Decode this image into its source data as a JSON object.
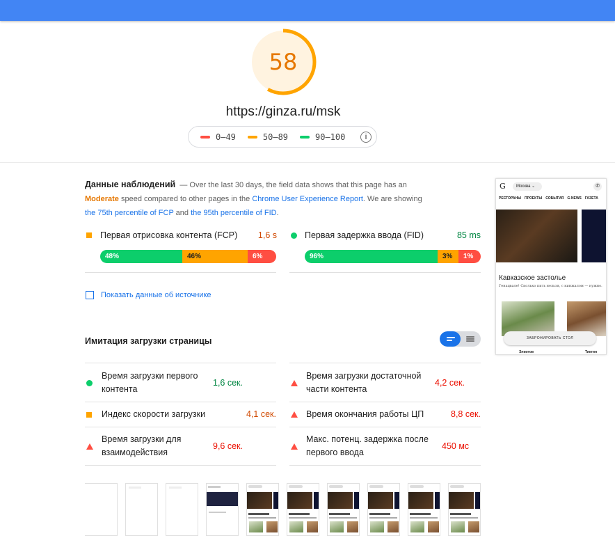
{
  "score": {
    "value": "58",
    "fraction": 0.58,
    "color": "#ffa400"
  },
  "url": "https://ginza.ru/msk",
  "legend": [
    {
      "label": "0–49",
      "color": "#ff4e42"
    },
    {
      "label": "50–89",
      "color": "#ffa400"
    },
    {
      "label": "90–100",
      "color": "#0cce6b"
    }
  ],
  "info_icon": "info-icon",
  "field": {
    "title": "Данные наблюдений",
    "t1": "— Over the last 30 days, the field data shows that this page has an",
    "moderate": "Moderate",
    "t2": "speed compared to other pages in the",
    "crux_link": "Chrome User Experience Report",
    "t3": ". We are showing",
    "fcp_link": "the 75th percentile of FCP",
    "t4": "and",
    "fid_link": "the 95th percentile of FID",
    "t5": ".",
    "fcp": {
      "label": "Первая отрисовка контента (FCP)",
      "value": "1,6 s",
      "dist": [
        "48%",
        "46%",
        "6%"
      ]
    },
    "fid": {
      "label": "Первая задержка ввода (FID)",
      "value": "85 ms",
      "dist": [
        "96%",
        "3%",
        "1%"
      ]
    },
    "origin_label": "Показать данные об источнике"
  },
  "lab": {
    "title": "Имитация загрузки страницы",
    "metrics": [
      {
        "label": "Время загрузки первого контента",
        "value": "1,6 сек."
      },
      {
        "label": "Время загрузки достаточной части контента",
        "value": "4,2 сек."
      },
      {
        "label": "Индекс скорости загрузки",
        "value": "4,1 сек."
      },
      {
        "label": "Время окончания работы ЦП",
        "value": "8,8 сек."
      },
      {
        "label": "Время загрузки для взаимодействия",
        "value": "9,6 сек."
      },
      {
        "label": "Макс. потенц. задержка после первого ввода",
        "value": "450 мс"
      }
    ]
  },
  "screenshot": {
    "city": "Москва",
    "nav": [
      "РЕСТОРАНЫ",
      "ПРОЕКТЫ",
      "СОБЫТИЯ",
      "G-NEWS",
      "ГАЗЕТА"
    ],
    "heading": "Кавказское застолье",
    "sub": "Генацвале! Сколько пить нельзя, с кинжалом — нужно.",
    "button": "ЗАБРОНИРОВАТЬ СТОЛ",
    "bottom_left": "Элиотов",
    "bottom_right": "Тиктин"
  }
}
